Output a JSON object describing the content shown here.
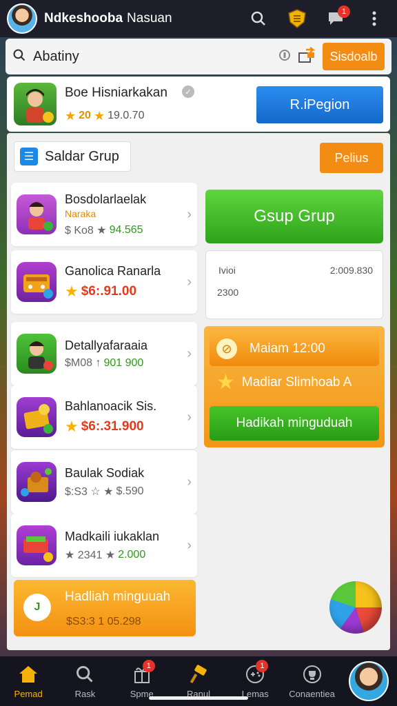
{
  "header": {
    "title_bold": "Ndkeshooba",
    "title_rest": "Nasuan",
    "notification_count": "1"
  },
  "search": {
    "label": "Abatiny",
    "action_label": "Sisdoalb"
  },
  "profile": {
    "name": "Boe Hisniarkakan",
    "stat_gold": "20",
    "stat_value": "19.0.70",
    "region_button": "R.iPegion"
  },
  "group": {
    "header_label": "Saldar Grup",
    "more_label": "Pelius",
    "big_button": "Gsup Grup"
  },
  "list": [
    {
      "title": "Bosdolarlaelak",
      "sub": "Naraka",
      "price_prefix": "$ Ko8 ★",
      "price_value": "94.565",
      "price_style": "green"
    },
    {
      "title": "Ganolica Ranarla",
      "sub": "",
      "price_prefix": "★",
      "price_value": "$6:.91.00",
      "price_style": "red"
    },
    {
      "title": "Detallyafaraaia",
      "sub": "",
      "price_prefix": "$M08 ↑",
      "price_value": "901 900",
      "price_style": "green"
    },
    {
      "title": "Bahlanoacik Sis.",
      "sub": "",
      "price_prefix": "★",
      "price_value": "$6:.31.900",
      "price_style": "red"
    },
    {
      "title": "Baulak Sodiak",
      "sub": "",
      "price_prefix": "$:S3 ☆ ★",
      "price_value": "$.590",
      "price_style": "gray"
    },
    {
      "title": "Madkaili iukaklan",
      "sub": "",
      "price_prefix": "★ 2341 ★",
      "price_value": "2.000",
      "price_style": "green"
    }
  ],
  "stats": {
    "left_top": "Ivioi",
    "left_bottom": "2300",
    "right_top": "2:009.830"
  },
  "reward": {
    "row1": "Maiam 12:00",
    "row2": "Madiar Slimhoab A",
    "button": "Hadikah minguduah"
  },
  "promo": {
    "title": "Hadliah minguuah",
    "value": "$S3:3 1 05.298",
    "chat_icon_text": "J"
  },
  "nav": [
    {
      "label": "Pemad",
      "icon": "home-icon",
      "active": true
    },
    {
      "label": "Rask",
      "icon": "search-icon",
      "active": false
    },
    {
      "label": "Spme",
      "icon": "gift-icon",
      "active": false,
      "badge": "1"
    },
    {
      "label": "Ranul",
      "icon": "hammer-icon",
      "active": false
    },
    {
      "label": "Lemas",
      "icon": "controller-icon",
      "active": false,
      "badge": "1"
    },
    {
      "label": "Conaentiea",
      "icon": "trophy-icon",
      "active": false
    }
  ]
}
